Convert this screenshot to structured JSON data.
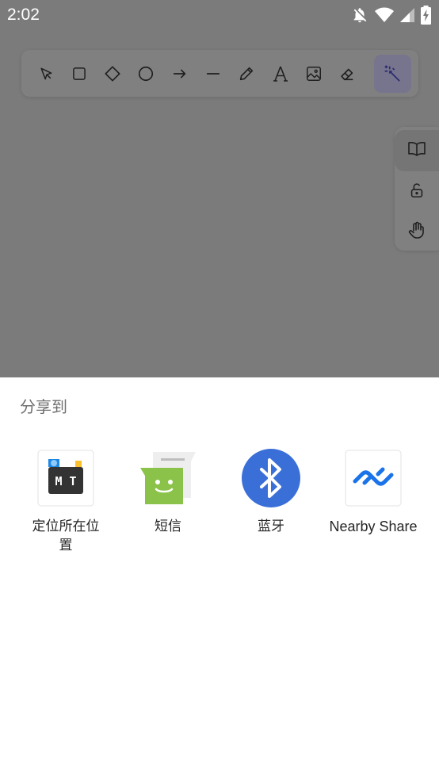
{
  "status_bar": {
    "time": "2:02",
    "icons": [
      "notifications-off-icon",
      "wifi-icon",
      "cell-signal-icon",
      "battery-charging-icon"
    ]
  },
  "toolbar": {
    "tools": [
      {
        "name": "select-tool",
        "icon": "cursor-arrow-icon"
      },
      {
        "name": "rectangle-tool",
        "icon": "square-icon"
      },
      {
        "name": "diamond-tool",
        "icon": "diamond-icon"
      },
      {
        "name": "ellipse-tool",
        "icon": "circle-icon"
      },
      {
        "name": "arrow-tool",
        "icon": "arrow-right-icon"
      },
      {
        "name": "line-tool",
        "icon": "line-icon"
      },
      {
        "name": "draw-tool",
        "icon": "pencil-icon"
      },
      {
        "name": "text-tool",
        "icon": "text-icon"
      },
      {
        "name": "image-tool",
        "icon": "image-icon"
      },
      {
        "name": "eraser-tool",
        "icon": "eraser-icon"
      },
      {
        "name": "laser-tool",
        "icon": "magic-wand-icon",
        "active": true
      }
    ],
    "active_color": "#77748e"
  },
  "side_panel": {
    "buttons": [
      {
        "name": "library-button",
        "icon": "book-open-icon",
        "active": true
      },
      {
        "name": "lock-button",
        "icon": "unlock-icon"
      },
      {
        "name": "hand-button",
        "icon": "hand-icon"
      }
    ]
  },
  "share_sheet": {
    "title": "分享到",
    "targets": [
      {
        "label": "定位所在位置",
        "icon": "mt-manager-icon"
      },
      {
        "label": "短信",
        "icon": "messages-icon"
      },
      {
        "label": "蓝牙",
        "icon": "bluetooth-icon"
      },
      {
        "label": "Nearby Share",
        "icon": "nearby-share-icon"
      }
    ]
  },
  "colors": {
    "scrim": "#7b7b7b",
    "bluetooth": "#3a6fd8",
    "messages": "#8bc34a",
    "nearby": "#1a73e8"
  }
}
